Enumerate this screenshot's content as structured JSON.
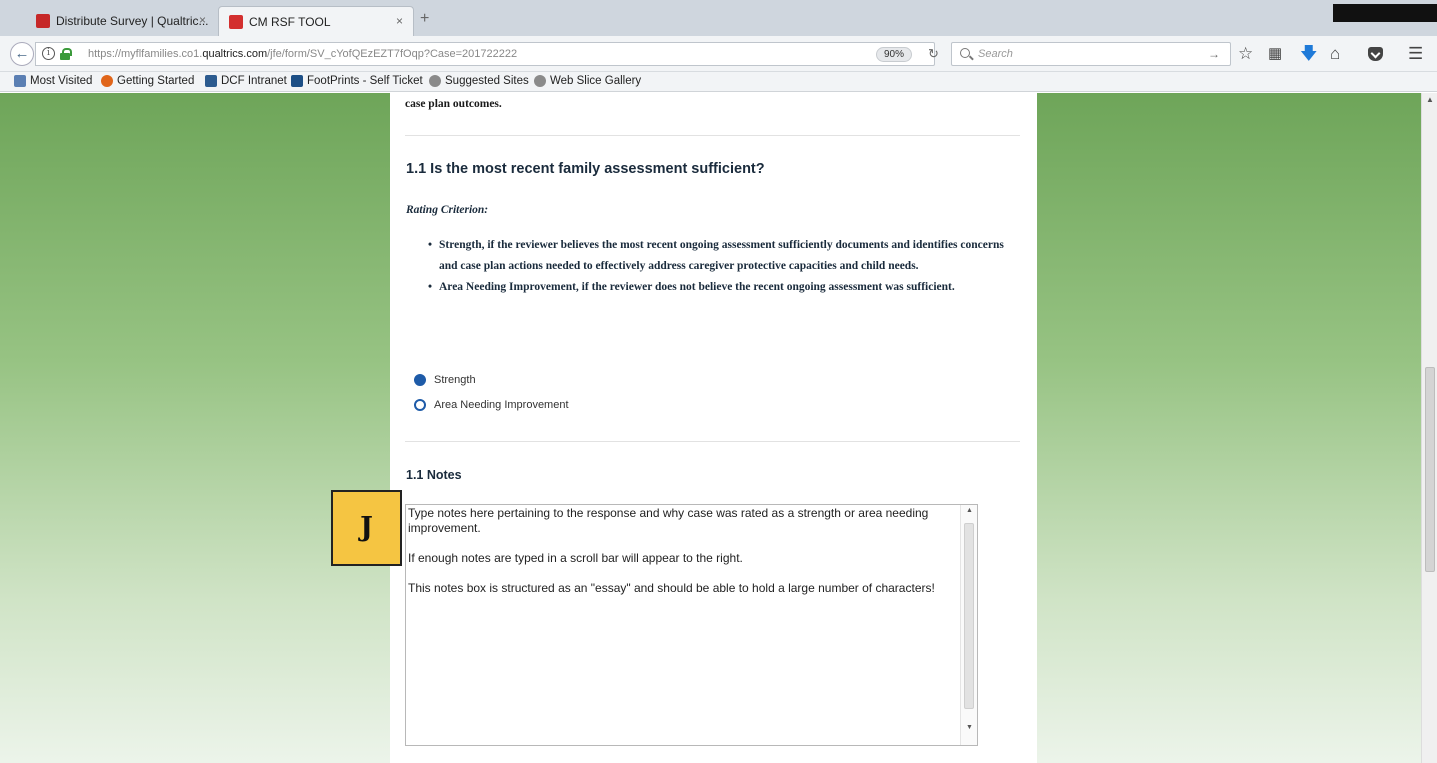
{
  "browser": {
    "tabs": [
      {
        "label": "Distribute Survey | Qualtric...",
        "close": "×",
        "active": false
      },
      {
        "label": "CM RSF TOOL",
        "close": "×",
        "active": true
      }
    ],
    "new_tab": "+",
    "url_prefix": "https://myflfamilies.co1.",
    "url_domain": "qualtrics.com",
    "url_suffix": "/jfe/form/SV_cYofQEzEZT7fOqp?Case=201722222",
    "zoom": "90%",
    "search_placeholder": "Search",
    "bookmarks": [
      "Most Visited",
      "Getting Started",
      "DCF Intranet",
      "FootPrints - Self Ticket",
      "Suggested Sites",
      "Web Slice Gallery"
    ],
    "icons": {
      "info": "info-icon",
      "lock": "lock-icon",
      "reload": "reload-icon",
      "star": "bookmark-star-icon",
      "reading_list": "reading-list-icon",
      "download": "download-icon",
      "home": "home-icon",
      "pocket": "pocket-icon",
      "menu": "menu-icon"
    }
  },
  "survey": {
    "previous_text": "case plan outcomes.",
    "question_title": "1.1  Is the most recent family assessment sufficient?",
    "rating_label": "Rating Criterion:",
    "criteria": [
      "Strength, if the reviewer believes the most recent ongoing assessment sufficiently documents and identifies concerns and case plan actions needed to effectively address caregiver protective capacities and child needs.",
      "Area Needing Improvement, if the reviewer does not believe the recent ongoing assessment was sufficient."
    ],
    "options": [
      {
        "label": "Strength",
        "selected": true
      },
      {
        "label": "Area Needing Improvement",
        "selected": false
      }
    ],
    "notes_title": "1.1 Notes",
    "notes_value": "Type notes here pertaining to the response and why case was rated as a strength or area needing improvement.\n\nIf enough notes are typed in a scroll bar will appear to the right.\n\nThis notes box is structured as an \"essay\" and should be able to hold a large number of characters!"
  },
  "callout": {
    "letter": "J",
    "color": "#f5c542"
  },
  "colors": {
    "accent": "#1e5ba8",
    "page_bg_top": "#6ea559",
    "page_bg_bottom": "#ecf4ea"
  }
}
